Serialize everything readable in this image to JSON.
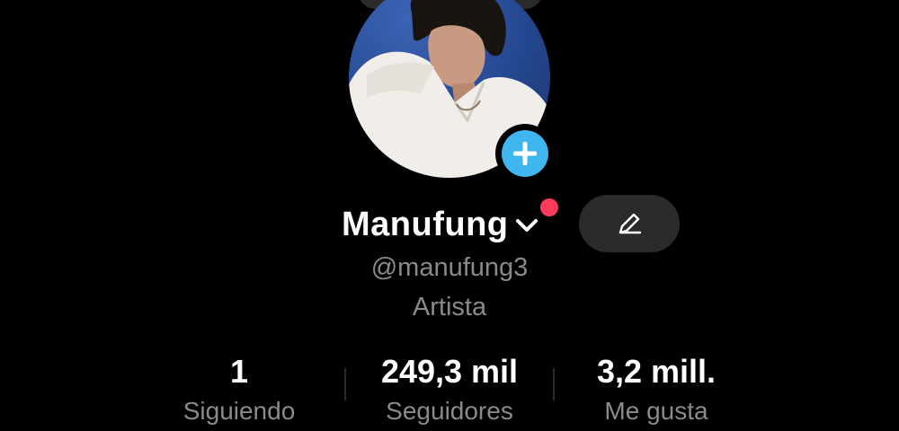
{
  "profile": {
    "display_name": "Manufung",
    "username": "@manufung3",
    "bio": "Artista"
  },
  "stats": [
    {
      "value": "1",
      "label": "Siguiendo"
    },
    {
      "value": "249,3 mil",
      "label": "Seguidores"
    },
    {
      "value": "3,2 mill.",
      "label": "Me gusta"
    }
  ],
  "icons": {
    "add": "plus-icon",
    "dropdown": "chevron-down-icon",
    "notification": "notification-dot",
    "edit": "pencil-icon"
  },
  "colors": {
    "background": "#000000",
    "add_button": "#3fb6ee",
    "notification_dot": "#ff3b5c",
    "secondary_text": "#8a8a8a",
    "button_bg": "#2b2b2b"
  }
}
